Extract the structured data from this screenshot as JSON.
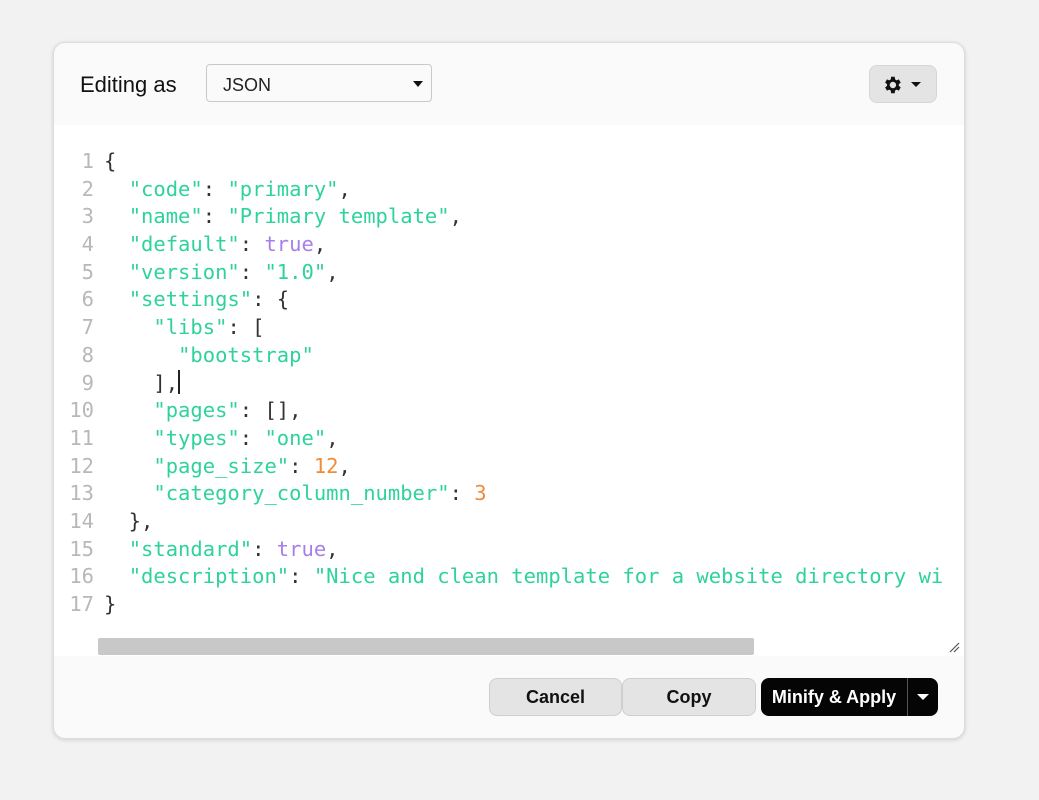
{
  "header": {
    "title": "Editing as",
    "format_select": {
      "value": "JSON",
      "options": [
        "JSON"
      ]
    },
    "settings_icon": "gear-icon"
  },
  "editor": {
    "lines": [
      {
        "num": "1",
        "tokens": [
          [
            "p",
            "{"
          ]
        ]
      },
      {
        "num": "2",
        "tokens": [
          [
            "p",
            "  "
          ],
          [
            "s",
            "\"code\""
          ],
          [
            "p",
            ": "
          ],
          [
            "s",
            "\"primary\""
          ],
          [
            "p",
            ","
          ]
        ]
      },
      {
        "num": "3",
        "tokens": [
          [
            "p",
            "  "
          ],
          [
            "s",
            "\"name\""
          ],
          [
            "p",
            ": "
          ],
          [
            "s",
            "\"Primary template\""
          ],
          [
            "p",
            ","
          ]
        ]
      },
      {
        "num": "4",
        "tokens": [
          [
            "p",
            "  "
          ],
          [
            "s",
            "\"default\""
          ],
          [
            "p",
            ": "
          ],
          [
            "b",
            "true"
          ],
          [
            "p",
            ","
          ]
        ]
      },
      {
        "num": "5",
        "tokens": [
          [
            "p",
            "  "
          ],
          [
            "s",
            "\"version\""
          ],
          [
            "p",
            ": "
          ],
          [
            "s",
            "\"1.0\""
          ],
          [
            "p",
            ","
          ]
        ]
      },
      {
        "num": "6",
        "tokens": [
          [
            "p",
            "  "
          ],
          [
            "s",
            "\"settings\""
          ],
          [
            "p",
            ": {"
          ]
        ]
      },
      {
        "num": "7",
        "tokens": [
          [
            "p",
            "    "
          ],
          [
            "s",
            "\"libs\""
          ],
          [
            "p",
            ": ["
          ]
        ]
      },
      {
        "num": "8",
        "tokens": [
          [
            "p",
            "      "
          ],
          [
            "s",
            "\"bootstrap\""
          ]
        ]
      },
      {
        "num": "9",
        "tokens": [
          [
            "p",
            "    ],"
          ]
        ],
        "cursor": true
      },
      {
        "num": "10",
        "tokens": [
          [
            "p",
            "    "
          ],
          [
            "s",
            "\"pages\""
          ],
          [
            "p",
            ": [],"
          ]
        ]
      },
      {
        "num": "11",
        "tokens": [
          [
            "p",
            "    "
          ],
          [
            "s",
            "\"types\""
          ],
          [
            "p",
            ": "
          ],
          [
            "s",
            "\"one\""
          ],
          [
            "p",
            ","
          ]
        ]
      },
      {
        "num": "12",
        "tokens": [
          [
            "p",
            "    "
          ],
          [
            "s",
            "\"page_size\""
          ],
          [
            "p",
            ": "
          ],
          [
            "n",
            "12"
          ],
          [
            "p",
            ","
          ]
        ]
      },
      {
        "num": "13",
        "tokens": [
          [
            "p",
            "    "
          ],
          [
            "s",
            "\"category_column_number\""
          ],
          [
            "p",
            ": "
          ],
          [
            "n",
            "3"
          ]
        ]
      },
      {
        "num": "14",
        "tokens": [
          [
            "p",
            "  },"
          ]
        ]
      },
      {
        "num": "15",
        "tokens": [
          [
            "p",
            "  "
          ],
          [
            "s",
            "\"standard\""
          ],
          [
            "p",
            ": "
          ],
          [
            "b",
            "true"
          ],
          [
            "p",
            ","
          ]
        ]
      },
      {
        "num": "16",
        "tokens": [
          [
            "p",
            "  "
          ],
          [
            "s",
            "\"description\""
          ],
          [
            "p",
            ": "
          ],
          [
            "s",
            "\"Nice and clean template for a website directory wi"
          ]
        ]
      },
      {
        "num": "17",
        "tokens": [
          [
            "p",
            "}"
          ]
        ]
      }
    ]
  },
  "footer": {
    "cancel_label": "Cancel",
    "copy_label": "Copy",
    "apply_label": "Minify & Apply"
  },
  "colors": {
    "string": "#2fd39a",
    "boolean": "#a87fe8",
    "number": "#ef8c3a",
    "punctuation": "#333333",
    "line_number": "#b8b8b8"
  }
}
